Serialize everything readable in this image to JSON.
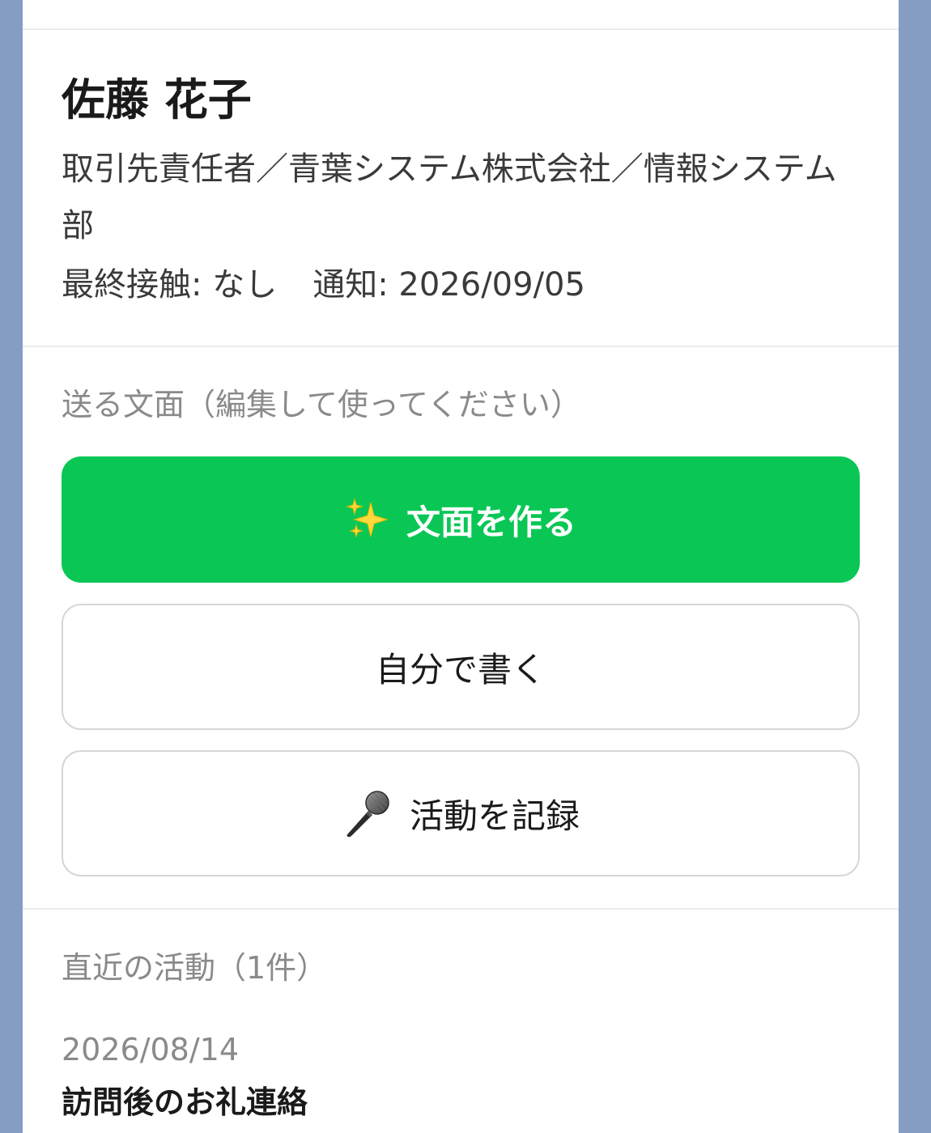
{
  "contact": {
    "name": "佐藤 花子",
    "role": "取引先責任者／青葉システム株式会社／情報システム部",
    "last_contact_label": "最終接触: なし",
    "notify_label": "通知: 2026/09/05"
  },
  "compose": {
    "section_label": "送る文面（編集して使ってください）",
    "generate_button_label": "文面を作る",
    "generate_button_icon": "sparkles-icon",
    "write_button_label": "自分で書く",
    "record_button_label": "活動を記録",
    "record_button_icon": "microphone-icon",
    "accent_color": "#0ac755"
  },
  "activity": {
    "section_label": "直近の活動（1件）",
    "items": [
      {
        "date": "2026/08/14",
        "title": "訪問後のお礼連絡"
      }
    ]
  }
}
